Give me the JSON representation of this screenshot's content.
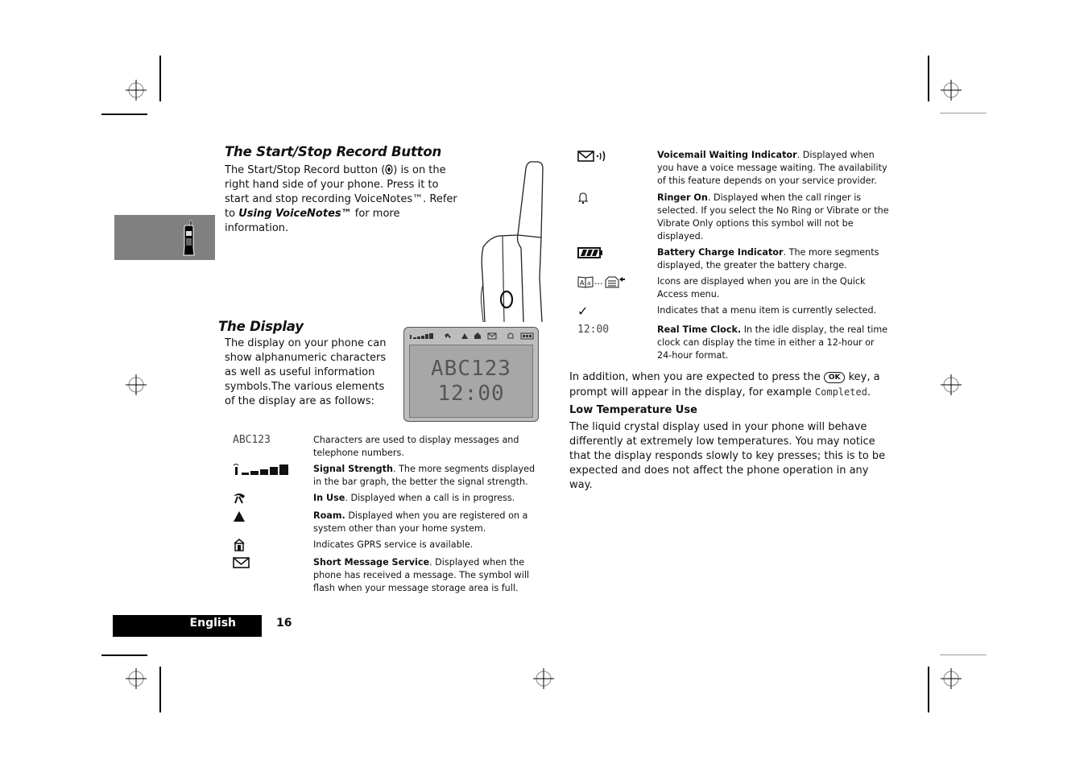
{
  "page": {
    "language_label": "English",
    "page_number": "16",
    "colors": {
      "tab_grey": "#808080",
      "lcd_bg": "#a7a7a7",
      "lcd_frame": "#8a8a8a",
      "footer_black": "#000000"
    }
  },
  "start_stop": {
    "title": "The Start/Stop Record Button",
    "p1": "The Start/Stop Record button (",
    "p2": ") is on the right hand side of your phone. Press it to start and stop recording VoiceNotes™. Refer to ",
    "link": "Using VoiceNotes™",
    "p3": " for more information."
  },
  "display_section": {
    "title": "The Display",
    "intro": "The display on your phone can show alphanumeric characters as well as useful information symbols.The various elements of the display are as follows:",
    "lcd": {
      "line1": "ABC123",
      "line2": "12:00"
    }
  },
  "left_items": [
    {
      "icon": "characters",
      "icon_text": "ABC123",
      "bold": "",
      "text": "Characters are used to display messages and telephone numbers."
    },
    {
      "icon": "signal-strength-icon",
      "bold": "Signal Strength",
      "text": ". The more segments displayed in the bar graph, the better the signal strength."
    },
    {
      "icon": "in-use-icon",
      "bold": "In Use",
      "text": ". Displayed when a call is in progress."
    },
    {
      "icon": "roam-icon",
      "bold": "Roam.",
      "text": " Displayed when you are registered on a system other than your home system."
    },
    {
      "icon": "gprs-icon",
      "bold": "",
      "text": "Indicates GPRS service is available."
    },
    {
      "icon": "envelope-icon",
      "bold": "Short Message Service",
      "text": ". Displayed when the phone has received a message. The symbol will flash when your message storage area is full."
    }
  ],
  "right_items": [
    {
      "icon": "voicemail-icon",
      "bold": "Voicemail Waiting Indicator",
      "text": ". Displayed when you have a voice message waiting. The availability of this feature depends on your service provider."
    },
    {
      "icon": "bell-icon",
      "bold": "Ringer On",
      "text": ". Displayed when the call ringer is selected. If you select the No Ring or Vibrate or the Vibrate Only options this symbol will not be displayed."
    },
    {
      "icon": "battery-icon",
      "bold": "Battery Charge Indicator",
      "text": ". The more segments displayed, the greater the battery charge."
    },
    {
      "icon": "quick-access-icon",
      "icon_text": "...",
      "bold": "",
      "text": "Icons are displayed when you are in the Quick Access menu."
    },
    {
      "icon": "checkmark-icon",
      "icon_text": "✓",
      "bold": "",
      "text": "Indicates that a menu item is currently selected."
    },
    {
      "icon": "clock",
      "icon_text": "12:00",
      "bold": "Real Time Clock.",
      "text": " In the idle display, the real time clock can display the time in either a 12-hour or 24-hour format."
    }
  ],
  "addition": {
    "p1": "In addition, when you are expected to press the ",
    "key": "OK",
    "p2": " key, a prompt will appear in the display, for example ",
    "example": "Completed",
    "p3": "."
  },
  "low_temp": {
    "title": "Low Temperature Use",
    "text": "The liquid crystal display used in your phone will behave differently at extremely low temperatures. You may notice that the display responds slowly to key presses; this is to be expected and does not affect the phone operation in any way."
  }
}
